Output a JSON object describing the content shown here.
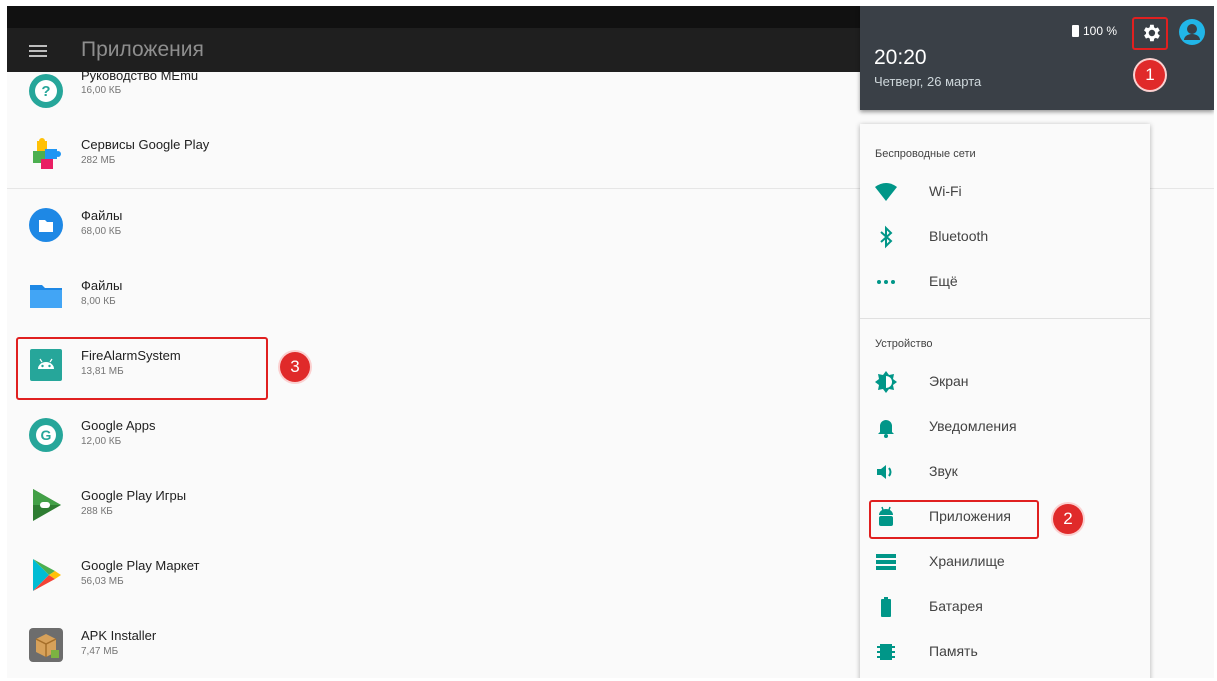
{
  "topbar": {
    "title": "Приложения"
  },
  "apps": [
    {
      "name": "Руководство MEmu",
      "size": "16,00 КБ",
      "icon": "help-icon"
    },
    {
      "name": "Сервисы Google Play",
      "size": "282 МБ",
      "icon": "puzzle-icon"
    },
    {
      "name": "Файлы",
      "size": "68,00 КБ",
      "icon": "file-icon"
    },
    {
      "name": "Файлы",
      "size": "8,00 КБ",
      "icon": "folder-icon"
    },
    {
      "name": "FireAlarmSystem",
      "size": "13,81 МБ",
      "icon": "android-app-icon"
    },
    {
      "name": "Google Apps",
      "size": "12,00 КБ",
      "icon": "google-g-icon"
    },
    {
      "name": "Google Play Игры",
      "size": "288 КБ",
      "icon": "gamepad-icon"
    },
    {
      "name": "Google Play Маркет",
      "size": "56,03 МБ",
      "icon": "play-store-icon"
    },
    {
      "name": "APK Installer",
      "size": "7,47 МБ",
      "icon": "package-icon"
    }
  ],
  "quick_settings": {
    "battery": "100 %",
    "time": "20:20",
    "date": "Четверг, 26 марта"
  },
  "settings": {
    "wireless_title": "Беспроводные сети",
    "device_title": "Устройство",
    "wireless": [
      {
        "label": "Wi-Fi",
        "icon": "wifi-icon"
      },
      {
        "label": "Bluetooth",
        "icon": "bluetooth-icon"
      },
      {
        "label": "Ещё",
        "icon": "more-icon"
      }
    ],
    "device": [
      {
        "label": "Экран",
        "icon": "brightness-icon"
      },
      {
        "label": "Уведомления",
        "icon": "bell-icon"
      },
      {
        "label": "Звук",
        "icon": "volume-icon"
      },
      {
        "label": "Приложения",
        "icon": "android-icon"
      },
      {
        "label": "Хранилище",
        "icon": "storage-icon"
      },
      {
        "label": "Батарея",
        "icon": "battery-icon"
      },
      {
        "label": "Память",
        "icon": "memory-icon"
      }
    ]
  },
  "annotations": {
    "step1": "1",
    "step2": "2",
    "step3": "3"
  },
  "colors": {
    "accent": "#009688",
    "highlight": "#e02020",
    "qs_background": "#3a4047"
  }
}
